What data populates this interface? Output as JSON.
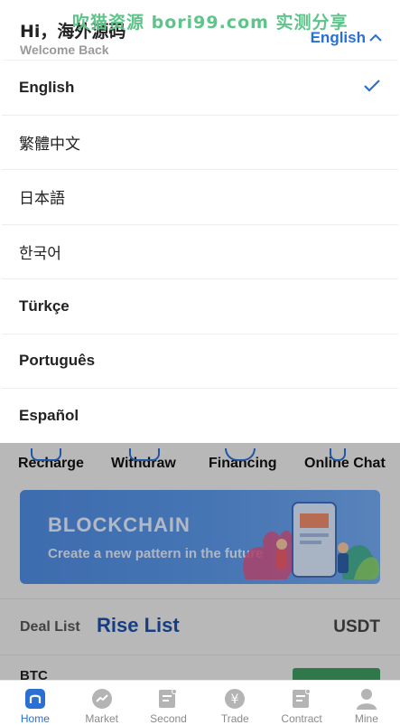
{
  "header": {
    "greeting": "Hi，海外源码",
    "welcome": "Welcome Back",
    "current_language": "English",
    "watermark": "吹猫资源 bori99.com 实测分享"
  },
  "language_menu": {
    "items": [
      {
        "label": "English",
        "selected": true
      },
      {
        "label": "繁體中文",
        "selected": false
      },
      {
        "label": "日本語",
        "selected": false
      },
      {
        "label": "한국어",
        "selected": false
      },
      {
        "label": "Türkçe",
        "selected": false
      },
      {
        "label": "Português",
        "selected": false
      },
      {
        "label": "Español",
        "selected": false
      }
    ]
  },
  "quick_actions": [
    "Recharge",
    "Withdraw",
    "Financing",
    "Online Chat"
  ],
  "banner": {
    "title": "BLOCKCHAIN",
    "subtitle": "Create a new pattern in the future"
  },
  "market_tabs": {
    "deal_list": "Deal List",
    "rise_list": "Rise List",
    "unit": "USDT"
  },
  "market_row": {
    "symbol": "BTC"
  },
  "bottom_nav": [
    {
      "label": "Home",
      "icon": "home-icon",
      "active": true
    },
    {
      "label": "Market",
      "icon": "chart-icon",
      "active": false
    },
    {
      "label": "Second",
      "icon": "document-icon",
      "active": false
    },
    {
      "label": "Trade",
      "icon": "yen-coin-icon",
      "active": false
    },
    {
      "label": "Contract",
      "icon": "contract-icon",
      "active": false
    },
    {
      "label": "Mine",
      "icon": "user-icon",
      "active": false
    }
  ],
  "colors": {
    "accent": "#2a6fd4",
    "watermark": "#5fc48a",
    "rise_tab": "#1d4fa8"
  }
}
